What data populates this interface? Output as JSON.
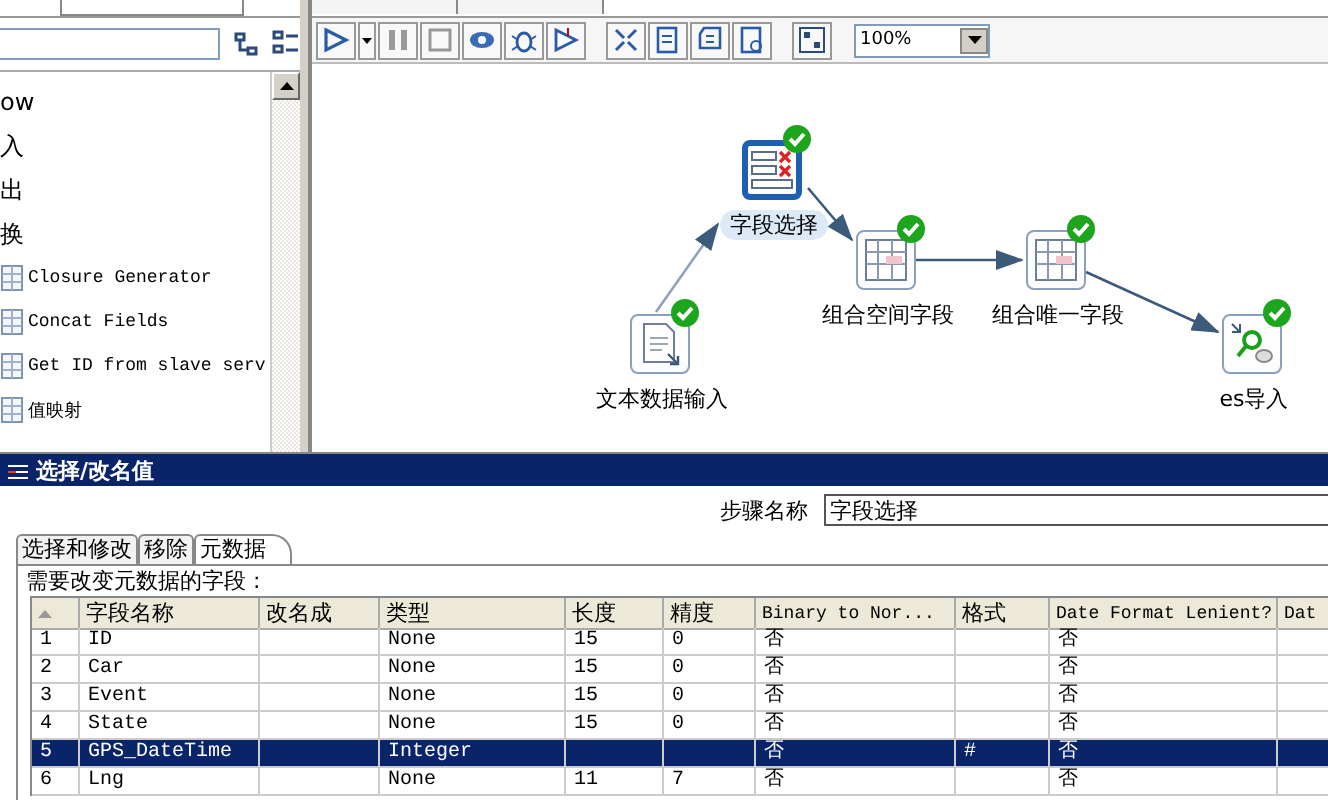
{
  "palette": {
    "items": [
      {
        "label": "ow",
        "kind": "folder"
      },
      {
        "label": "入",
        "kind": "folder"
      },
      {
        "label": "出",
        "kind": "folder"
      },
      {
        "label": "换",
        "kind": "folder"
      },
      {
        "label": "Closure Generator",
        "kind": "step"
      },
      {
        "label": "Concat Fields",
        "kind": "step"
      },
      {
        "label": "Get ID from slave serv",
        "kind": "step"
      },
      {
        "label": "值映射",
        "kind": "step"
      }
    ]
  },
  "toolbar": {
    "zoom": "100%"
  },
  "canvas": {
    "nodes": [
      {
        "label": "字段选择",
        "selected": true,
        "ok": true
      },
      {
        "label": "文本数据输入",
        "selected": false,
        "ok": true
      },
      {
        "label": "组合空间字段",
        "selected": false,
        "ok": true
      },
      {
        "label": "组合唯一字段",
        "selected": false,
        "ok": true
      },
      {
        "label": "es导入",
        "selected": false,
        "ok": true
      }
    ]
  },
  "dialog": {
    "title": "选择/改名值",
    "step_name_label": "步骤名称",
    "step_name": "字段选择",
    "tabs": [
      {
        "label": "选择和修改",
        "selected": false
      },
      {
        "label": "移除",
        "selected": false
      },
      {
        "label": "元数据",
        "selected": true
      }
    ],
    "fields_label": "需要改变元数据的字段 :",
    "table": {
      "columns": [
        "字段名称",
        "改名成",
        "类型",
        "长度",
        "精度",
        "Binary to Nor...",
        "格式",
        "Date Format Lenient?",
        "Dat"
      ],
      "rows": [
        {
          "num": "1",
          "cells": [
            "ID",
            "",
            "None",
            "15",
            "0",
            "否",
            "",
            "否",
            ""
          ],
          "selected": false
        },
        {
          "num": "2",
          "cells": [
            "Car",
            "",
            "None",
            "15",
            "0",
            "否",
            "",
            "否",
            ""
          ],
          "selected": false
        },
        {
          "num": "3",
          "cells": [
            "Event",
            "",
            "None",
            "15",
            "0",
            "否",
            "",
            "否",
            ""
          ],
          "selected": false
        },
        {
          "num": "4",
          "cells": [
            "State",
            "",
            "None",
            "15",
            "0",
            "否",
            "",
            "否",
            ""
          ],
          "selected": false
        },
        {
          "num": "5",
          "cells": [
            "GPS_DateTime",
            "",
            "Integer",
            "",
            "",
            "否",
            "#",
            "否",
            ""
          ],
          "selected": true
        },
        {
          "num": "6",
          "cells": [
            "Lng",
            "",
            "None",
            "11",
            "7",
            "否",
            "",
            "否",
            ""
          ],
          "selected": false
        }
      ]
    }
  }
}
